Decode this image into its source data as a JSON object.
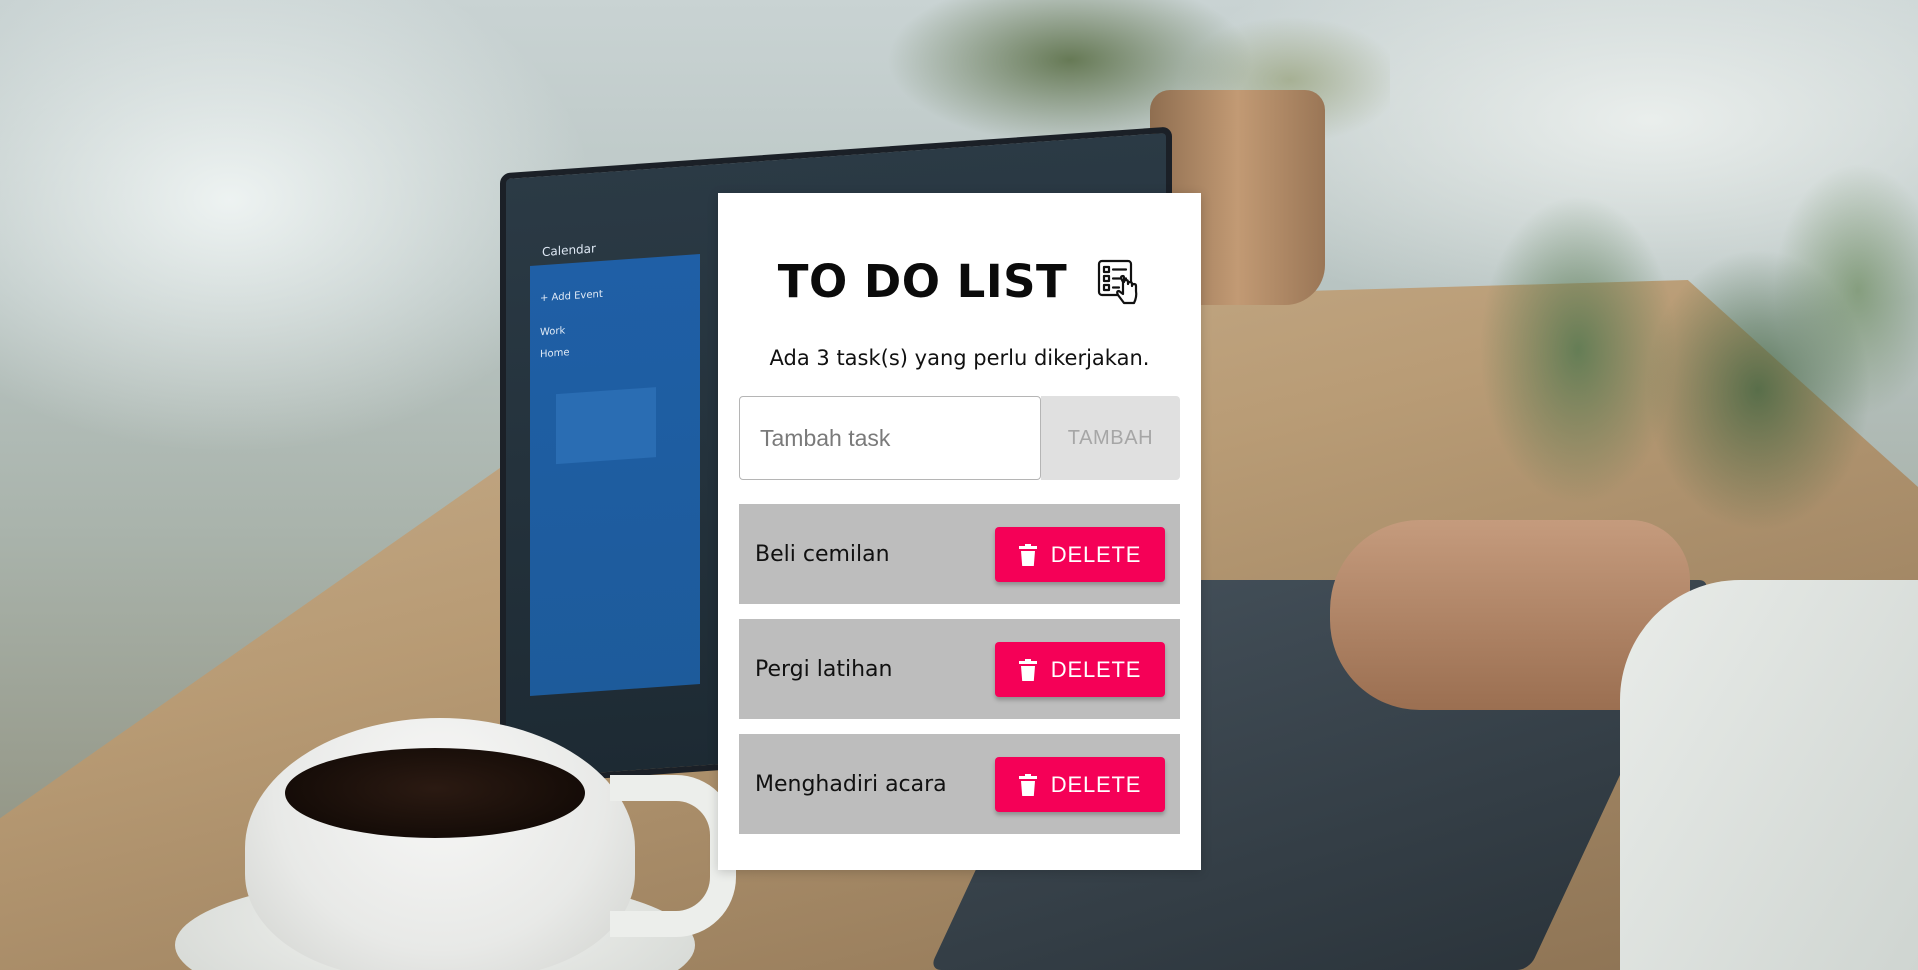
{
  "background": {
    "calendar_title": "Calendar",
    "calendar_add_event": "+ Add Event",
    "calendar_work": "Work",
    "calendar_home": "Home"
  },
  "app": {
    "title": "TO DO LIST",
    "title_icon": "checklist-hand-icon",
    "summary": "Ada 3 task(s) yang perlu dikerjakan."
  },
  "form": {
    "placeholder": "Tambah task",
    "value": "",
    "add_label": "TAMBAH"
  },
  "tasks": [
    {
      "label": "Beli cemilan",
      "delete_label": "DELETE"
    },
    {
      "label": "Pergi latihan",
      "delete_label": "DELETE"
    },
    {
      "label": "Menghadiri acara",
      "delete_label": "DELETE"
    }
  ],
  "colors": {
    "delete_button": "#f50057",
    "task_background": "#bdbdbd",
    "add_button_disabled": "#e0e0e0"
  }
}
